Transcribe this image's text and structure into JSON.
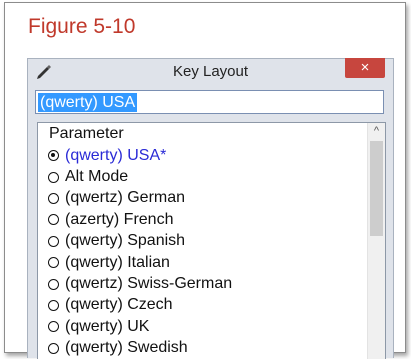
{
  "figure": {
    "caption": "Figure 5-10"
  },
  "window": {
    "title": "Key Layout",
    "close_label": "×",
    "app_icon": "pencil-icon"
  },
  "search": {
    "value": "(qwerty) USA"
  },
  "list": {
    "header": "Parameter",
    "selected_index": 0,
    "items": [
      {
        "label": "(qwerty) USA*",
        "selected": true
      },
      {
        "label": "Alt Mode",
        "selected": false
      },
      {
        "label": "(qwertz) German",
        "selected": false
      },
      {
        "label": "(azerty) French",
        "selected": false
      },
      {
        "label": "(qwerty) Spanish",
        "selected": false
      },
      {
        "label": "(qwerty) Italian",
        "selected": false
      },
      {
        "label": "(qwertz) Swiss-German",
        "selected": false
      },
      {
        "label": "(qwerty) Czech",
        "selected": false
      },
      {
        "label": "(qwerty) UK",
        "selected": false
      },
      {
        "label": "(qwerty) Swedish",
        "selected": false
      }
    ],
    "scroll_up_glyph": "^"
  },
  "colors": {
    "caption": "#c0392b",
    "selected_item": "#2a2ad6",
    "selection_highlight": "#3399ff",
    "close_button": "#c7463e"
  }
}
